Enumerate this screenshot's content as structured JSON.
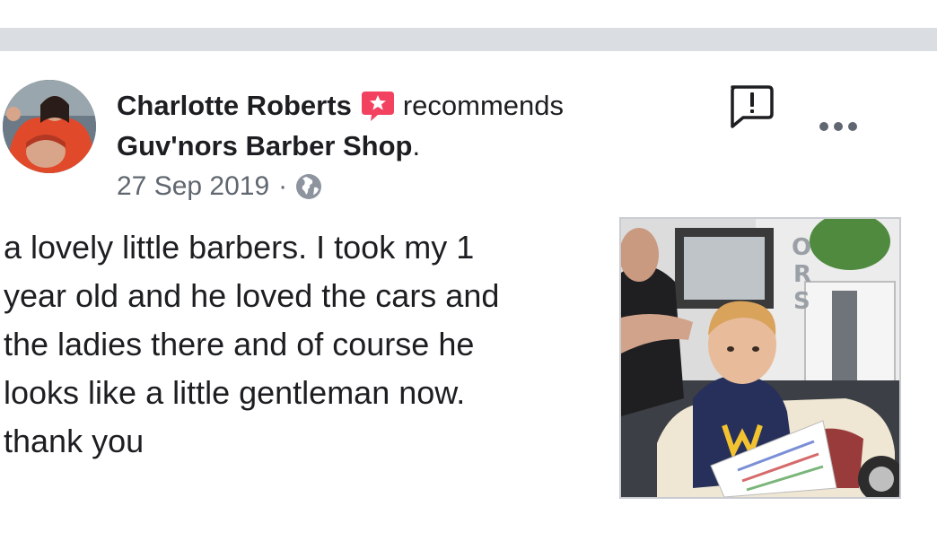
{
  "post": {
    "author": "Charlotte Roberts",
    "action": "recommends",
    "page_name": "Guv'nors Barber Shop",
    "page_suffix": ".",
    "date": "27 Sep 2019",
    "separator": "·",
    "privacy_icon": "globe-icon",
    "recommend_icon": "recommendation-badge-icon",
    "body": "a lovely little barbers. I took my 1\nyear old and he loved the cars and\nthe ladies there and of course he\nlooks like a little gentleman now.\nthank you"
  },
  "actions": {
    "report_icon": "report-icon",
    "more_icon": "more-options-icon"
  },
  "colors": {
    "text": "#1c1e21",
    "meta": "#606770",
    "divider": "#dadde1",
    "badge": "#f3425f"
  }
}
